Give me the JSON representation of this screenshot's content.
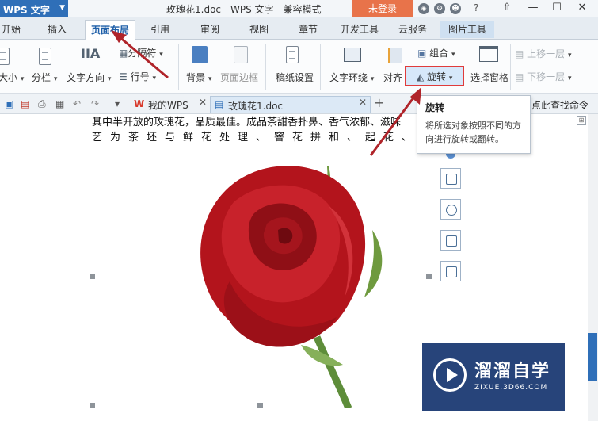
{
  "titlebar": {
    "app_menu": "WPS 文字",
    "window_title": "玫瑰花1.doc - WPS 文字 - 兼容模式",
    "login_button": "未登录",
    "help": "?",
    "minimize": "—",
    "maximize": "☐",
    "close": "✕"
  },
  "tabs": [
    "开始",
    "插入",
    "页面布局",
    "引用",
    "审阅",
    "视图",
    "章节",
    "开发工具",
    "云服务",
    "图片工具"
  ],
  "active_tab": "页面布局",
  "ribbon": {
    "size": "大小",
    "columns": "分栏",
    "text_direction": "文字方向",
    "separator": "分隔符",
    "line_number": "行号",
    "background": "背景",
    "page_border": "页面边框",
    "draft_settings": "稿纸设置",
    "text_wrap": "文字环绕",
    "align": "对齐",
    "group": "组合",
    "rotate": "旋转",
    "selection_pane": "选择窗格",
    "bring_forward": "上移一层",
    "send_backward": "下移一层"
  },
  "quickbar": {
    "doc_tabs": [
      {
        "label": "我的WPS"
      },
      {
        "label": "玫瑰花1.doc"
      }
    ],
    "add_tab": "+",
    "hint": "点此查找命令"
  },
  "document": {
    "line1": "其中半开放的玫瑰花，品质最佳。成品茶甜香扑鼻、香气浓郁、滋味",
    "line2": "艺为茶坯与鲜花处理、窨花拼和、起花、"
  },
  "tooltip": {
    "title": "旋转",
    "description": "将所选对象按照不同的方向进行旋转或翻转。"
  },
  "watermark": {
    "main": "溜溜自学",
    "sub": "ZIXUE.3D66.COM"
  },
  "colors": {
    "app_blue": "#2f6fb8",
    "login_orange": "#e8734a",
    "highlight_red": "#e03b3b",
    "rose_red": "#b3141c"
  }
}
